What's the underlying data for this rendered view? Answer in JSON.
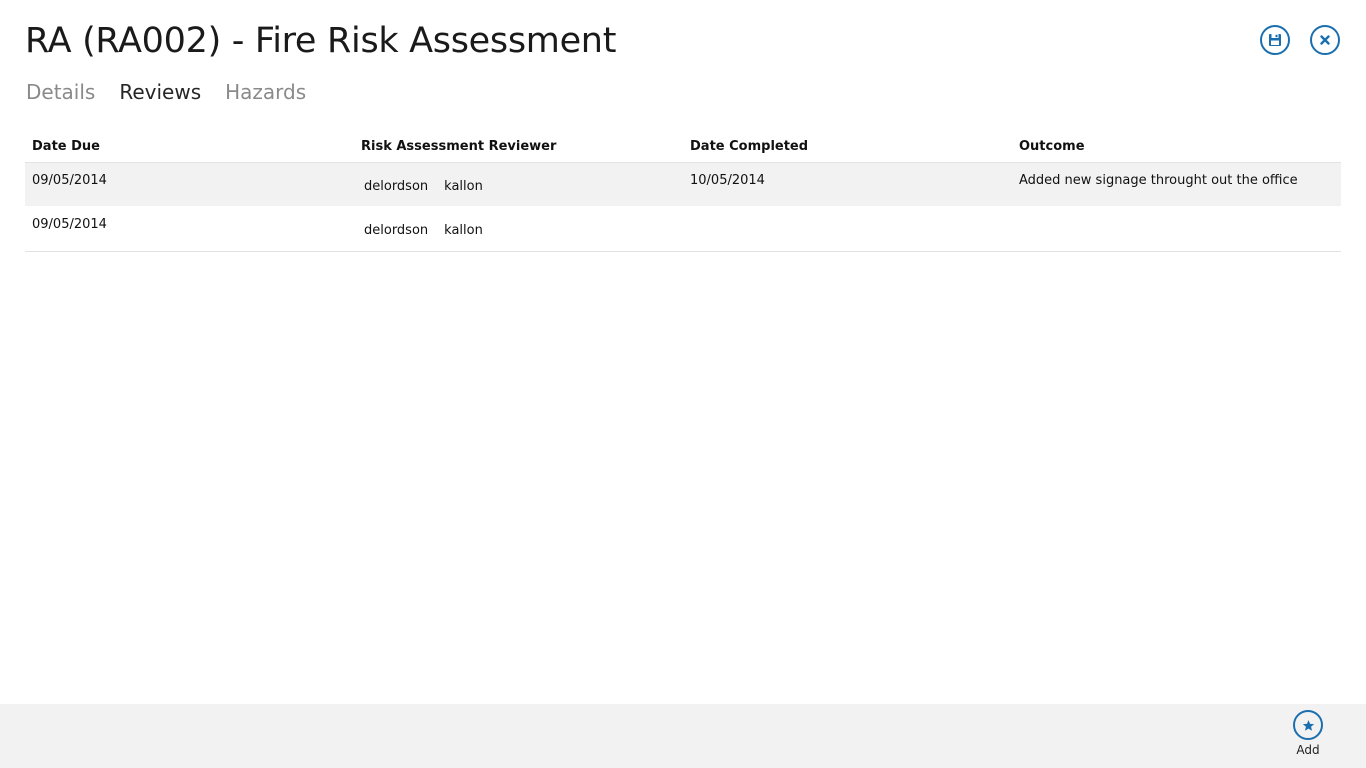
{
  "header": {
    "title": "RA (RA002) - Fire Risk Assessment",
    "save_icon": "save-icon",
    "close_icon": "close-icon",
    "accent_color": "#1b6fae"
  },
  "tabs": [
    {
      "label": "Details",
      "active": false
    },
    {
      "label": "Reviews",
      "active": true
    },
    {
      "label": "Hazards",
      "active": false
    }
  ],
  "grid": {
    "columns": [
      "Date Due",
      "Risk Assessment Reviewer",
      "Date Completed",
      "Outcome"
    ],
    "rows": [
      {
        "date_due": "09/05/2014",
        "reviewers": [
          "delordson",
          "kallon"
        ],
        "date_completed": "10/05/2014",
        "outcome": "Added new signage throught out the office"
      },
      {
        "date_due": "09/05/2014",
        "reviewers": [
          "delordson",
          "kallon"
        ],
        "date_completed": "",
        "outcome": ""
      }
    ]
  },
  "appbar": {
    "add_label": "Add",
    "add_icon": "star-icon"
  }
}
